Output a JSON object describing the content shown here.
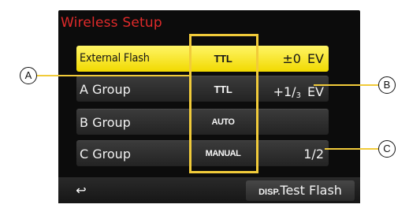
{
  "title": "Wireless Setup",
  "rows": [
    {
      "label": "External Flash",
      "mode": "TTL",
      "sign": "±0",
      "frac_num": "",
      "frac_den": "",
      "ev": "EV",
      "value": ""
    },
    {
      "label": "A Group",
      "mode": "TTL",
      "sign": "+1",
      "frac_num": "",
      "frac_den": "3",
      "ev": "EV",
      "value": ""
    },
    {
      "label": "B Group",
      "mode": "AUTO",
      "sign": "",
      "frac_num": "",
      "frac_den": "",
      "ev": "",
      "value": ""
    },
    {
      "label": "C Group",
      "mode": "MANUAL",
      "sign": "",
      "frac_num": "",
      "frac_den": "",
      "ev": "",
      "value": "1/2"
    }
  ],
  "footer": {
    "back_icon": "↩",
    "disp_label": "DISP.",
    "test_flash_label": "Test Flash"
  },
  "callouts": {
    "a": "A",
    "b": "B",
    "c": "C"
  },
  "colors": {
    "title": "#e02a2a",
    "selected": "#f4e000",
    "highlight": "#f1cb3a"
  }
}
